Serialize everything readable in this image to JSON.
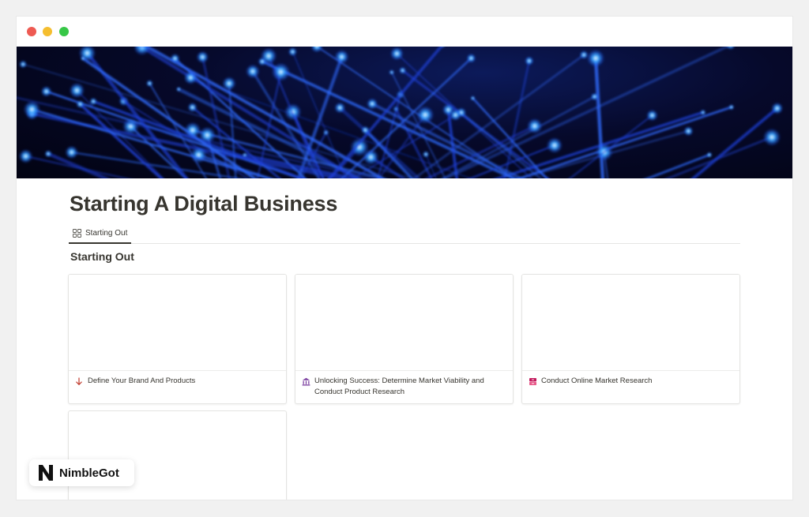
{
  "window": {
    "controls": [
      "close",
      "minimize",
      "maximize"
    ]
  },
  "cover": {
    "description_icon": "fiber-optic-cover-image"
  },
  "page": {
    "title": "Starting A Digital Business",
    "tabs": [
      {
        "label": "Starting Out",
        "icon": "gallery-grid-icon",
        "active": true
      }
    ],
    "section_heading": "Starting Out"
  },
  "gallery": {
    "cards": [
      {
        "title": "Define Your Brand And Products",
        "icon": "arrow-down-icon",
        "icon_color": "#c0392b"
      },
      {
        "title": "Unlocking Success: Determine Market Viability and Conduct Product Research",
        "icon": "bank-icon",
        "icon_color": "#7b3fa0"
      },
      {
        "title": "Conduct Online Market Research",
        "icon": "file-cabinet-icon",
        "icon_color": "#c2185b"
      }
    ]
  },
  "badge": {
    "label": "NimbleGot",
    "icon": "nimblegot-logo"
  },
  "colors": {
    "background": "#f1f1f1",
    "text": "#37352f",
    "close": "#ee5a52",
    "minimize": "#f5be2f",
    "maximize": "#37c747"
  }
}
